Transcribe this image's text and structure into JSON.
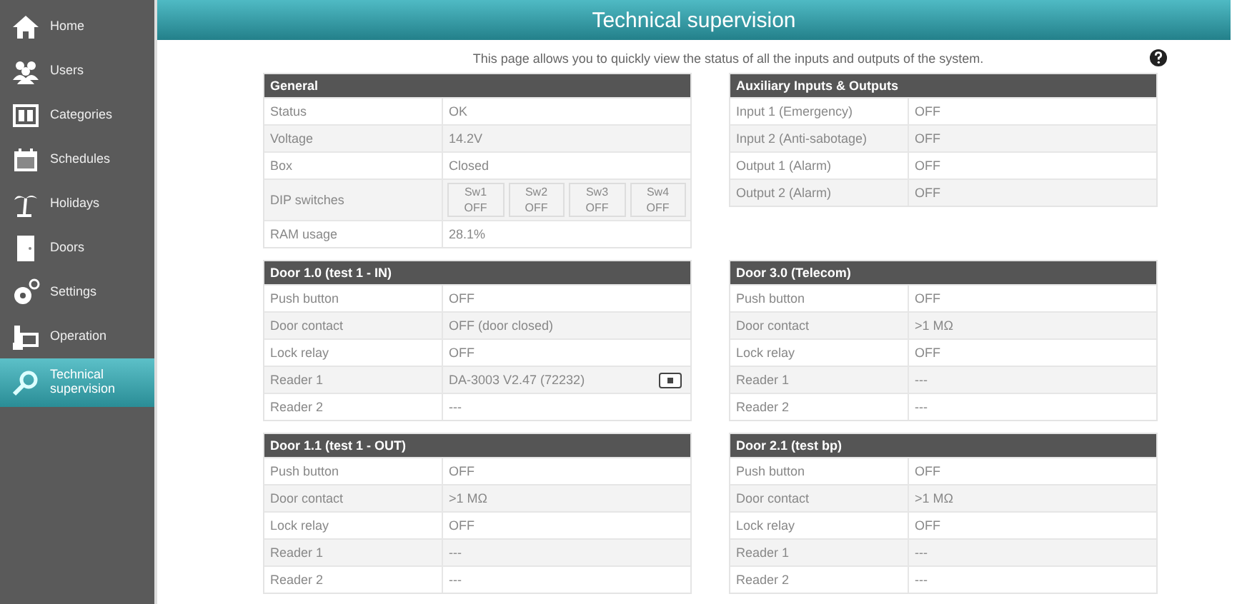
{
  "sidebar": {
    "items": [
      {
        "label": "Home",
        "kind": "home",
        "selected": false
      },
      {
        "label": "Users",
        "kind": "users",
        "selected": false
      },
      {
        "label": "Categories",
        "kind": "categories",
        "selected": false
      },
      {
        "label": "Schedules",
        "kind": "calendar",
        "selected": false
      },
      {
        "label": "Holidays",
        "kind": "palm",
        "selected": false
      },
      {
        "label": "Doors",
        "kind": "door",
        "selected": false
      },
      {
        "label": "Settings",
        "kind": "gears",
        "selected": false
      },
      {
        "label": "Operation",
        "kind": "operation",
        "selected": false
      },
      {
        "label": "Technical supervision",
        "kind": "search",
        "selected": true
      }
    ]
  },
  "header": {
    "title": "Technical supervision"
  },
  "intro": "This page allows you to quickly view the status of all the inputs and outputs of the system.",
  "panels": [
    {
      "title": "General",
      "rows": [
        {
          "kind": "text",
          "label": "Status",
          "value": "OK"
        },
        {
          "kind": "text",
          "label": "Voltage",
          "value": "14.2V"
        },
        {
          "kind": "text",
          "label": "Box",
          "value": "Closed"
        },
        {
          "kind": "dip",
          "label": "DIP switches",
          "switches": [
            {
              "name": "Sw1",
              "value": "OFF"
            },
            {
              "name": "Sw2",
              "value": "OFF"
            },
            {
              "name": "Sw3",
              "value": "OFF"
            },
            {
              "name": "Sw4",
              "value": "OFF"
            }
          ]
        },
        {
          "kind": "text",
          "label": "RAM usage",
          "value": "28.1%"
        }
      ]
    },
    {
      "title": "Auxiliary Inputs & Outputs",
      "rows": [
        {
          "kind": "text",
          "label": "Input 1 (Emergency)",
          "value": "OFF"
        },
        {
          "kind": "text",
          "label": "Input 2 (Anti-sabotage)",
          "value": "OFF"
        },
        {
          "kind": "text",
          "label": "Output 1 (Alarm)",
          "value": "OFF"
        },
        {
          "kind": "text",
          "label": "Output 2 (Alarm)",
          "value": "OFF"
        }
      ]
    },
    {
      "title": "Door 1.0 (test 1 - IN)",
      "rows": [
        {
          "kind": "text",
          "label": "Push button",
          "value": "OFF"
        },
        {
          "kind": "text",
          "label": "Door contact",
          "value": "OFF (door closed)"
        },
        {
          "kind": "text",
          "label": "Lock relay",
          "value": "OFF"
        },
        {
          "kind": "reader",
          "label": "Reader 1",
          "value": "DA-3003 V2.47 (72232)"
        },
        {
          "kind": "text",
          "label": "Reader 2",
          "value": "---"
        }
      ]
    },
    {
      "title": "Door 3.0 (Telecom)",
      "rows": [
        {
          "kind": "text",
          "label": "Push button",
          "value": "OFF"
        },
        {
          "kind": "text",
          "label": "Door contact",
          "value": ">1 MΩ"
        },
        {
          "kind": "text",
          "label": "Lock relay",
          "value": "OFF"
        },
        {
          "kind": "text",
          "label": "Reader 1",
          "value": "---"
        },
        {
          "kind": "text",
          "label": "Reader 2",
          "value": "---"
        }
      ]
    },
    {
      "title": "Door 1.1 (test 1 - OUT)",
      "rows": [
        {
          "kind": "text",
          "label": "Push button",
          "value": "OFF"
        },
        {
          "kind": "text",
          "label": "Door contact",
          "value": ">1 MΩ"
        },
        {
          "kind": "text",
          "label": "Lock relay",
          "value": "OFF"
        },
        {
          "kind": "text",
          "label": "Reader 1",
          "value": "---"
        },
        {
          "kind": "text",
          "label": "Reader 2",
          "value": "---"
        }
      ]
    },
    {
      "title": "Door 2.1 (test bp)",
      "rows": [
        {
          "kind": "text",
          "label": "Push button",
          "value": "OFF"
        },
        {
          "kind": "text",
          "label": "Door contact",
          "value": ">1 MΩ"
        },
        {
          "kind": "text",
          "label": "Lock relay",
          "value": "OFF"
        },
        {
          "kind": "text",
          "label": "Reader 1",
          "value": "---"
        },
        {
          "kind": "text",
          "label": "Reader 2",
          "value": "---"
        }
      ]
    }
  ]
}
